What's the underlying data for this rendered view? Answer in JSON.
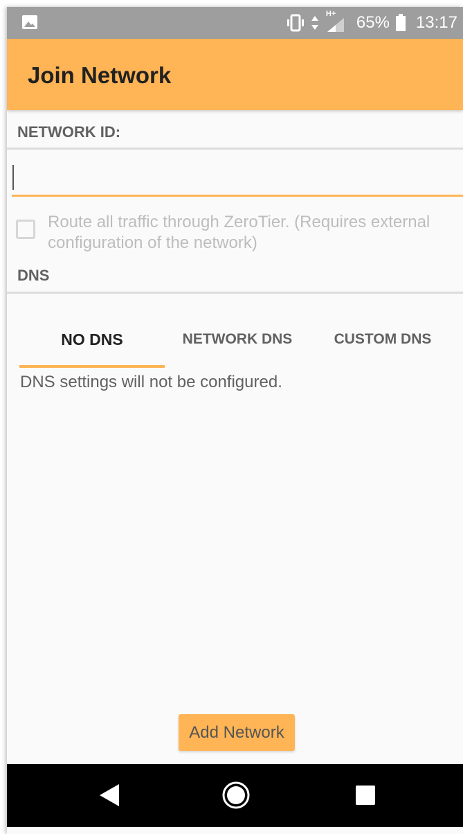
{
  "status_bar": {
    "battery_percent": "65%",
    "time": "13:17",
    "network_type": "H+",
    "icons": [
      "image-icon",
      "vibrate-icon",
      "data-arrows-icon",
      "signal-icon",
      "battery-icon"
    ]
  },
  "app_bar": {
    "title": "Join Network"
  },
  "network_id": {
    "header": "NETWORK ID:",
    "value": "",
    "placeholder": ""
  },
  "route_option": {
    "label": "Route all traffic through ZeroTier. (Requires external configuration of the network)",
    "checked": false
  },
  "dns": {
    "header": "DNS",
    "tabs": [
      {
        "label": "NO DNS",
        "active": true
      },
      {
        "label": "NETWORK DNS",
        "active": false
      },
      {
        "label": "CUSTOM DNS",
        "active": false
      }
    ],
    "description": "DNS settings will not be configured."
  },
  "actions": {
    "add_network": "Add Network"
  },
  "nav_bar": {
    "icons": [
      "back-icon",
      "home-icon",
      "recents-icon"
    ]
  },
  "colors": {
    "accent": "#ffb455",
    "status_bar": "#9e9e9e",
    "background": "#fafafa"
  }
}
